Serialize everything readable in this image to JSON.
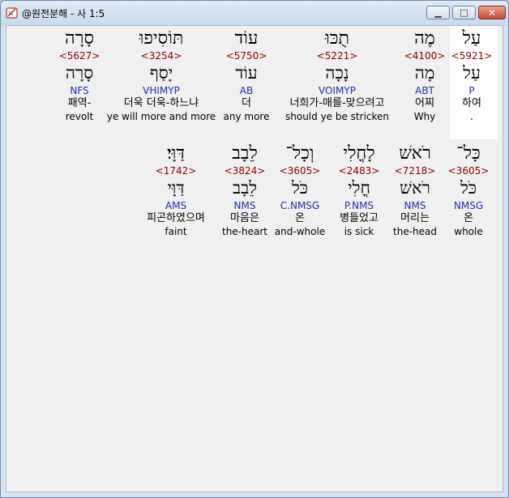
{
  "window": {
    "title": "@원전분해 - 사 1:5"
  },
  "rows": [
    {
      "words": [
        {
          "hebrew": "עַל",
          "strong": "<5921>",
          "lemma": "עַל",
          "parse": "P",
          "korean": "하여",
          "english": "."
        },
        {
          "hebrew": "מֶה",
          "strong": "<4100>",
          "lemma": "מָה",
          "parse": "ABT",
          "korean": "어찌",
          "english": "Why"
        },
        {
          "hebrew": "תֻכּוּ",
          "strong": "<5221>",
          "lemma": "נָכָה",
          "parse": "VOIMYP",
          "korean": "너희가-매를-맞으려고",
          "english": "should ye be stricken"
        },
        {
          "hebrew": "עוֹד",
          "strong": "<5750>",
          "lemma": "עוֹד",
          "parse": "AB",
          "korean": "더",
          "english": "any more"
        },
        {
          "hebrew": "תּוֹסִיפוּ",
          "strong": "<3254>",
          "lemma": "יָסַף",
          "parse": "VHIMYP",
          "korean": "더욱 더욱-하느냐",
          "english": "ye will more and more"
        },
        {
          "hebrew": "סָרָה",
          "strong": "<5627>",
          "lemma": "סָרָה",
          "parse": "NFS",
          "korean": "패역-",
          "english": "revolt"
        }
      ]
    },
    {
      "words": [
        {
          "hebrew": "כָּל־",
          "strong": "<3605>",
          "lemma": "כֹּל",
          "parse": "NMSG",
          "korean": "온",
          "english": "whole"
        },
        {
          "hebrew": "רֹאשׁ",
          "strong": "<7218>",
          "lemma": "רֹאשׁ",
          "parse": "NMS",
          "korean": "머리는",
          "english": "the-head"
        },
        {
          "hebrew": "לָחֳלִי",
          "strong": "<2483>",
          "lemma": "חֳלִי",
          "parse": "P.NMS",
          "korean": "병들었고",
          "english": "is sick"
        },
        {
          "hebrew": "וְכָל־",
          "strong": "<3605>",
          "lemma": "כֹּל",
          "parse": "C.NMSG",
          "korean": "온",
          "english": "and-whole"
        },
        {
          "hebrew": "לֵבָב",
          "strong": "<3824>",
          "lemma": "לֵבָב",
          "parse": "NMS",
          "korean": "마음은",
          "english": "the-heart"
        },
        {
          "hebrew": "דַּוָּי׃",
          "strong": "<1742>",
          "lemma": "דַּוָּי",
          "parse": "AMS",
          "korean": "피곤하였으며",
          "english": "faint"
        }
      ]
    }
  ]
}
